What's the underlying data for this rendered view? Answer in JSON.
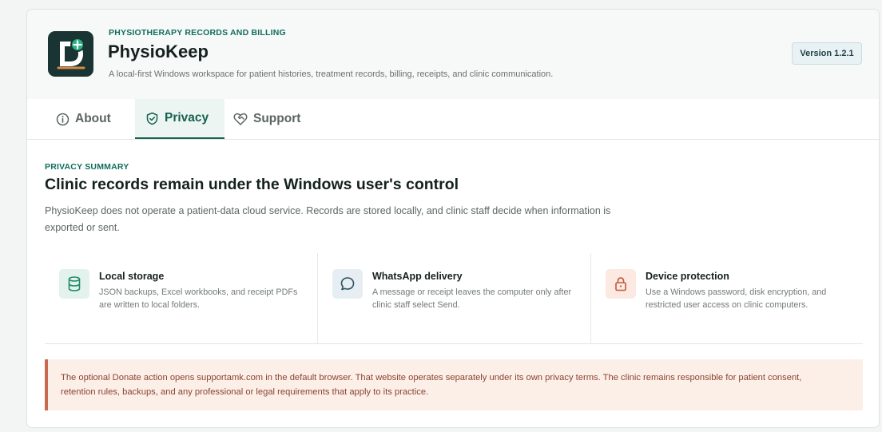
{
  "app": {
    "eyebrow": "PHYSIOTHERAPY RECORDS AND BILLING",
    "name": "PhysioKeep",
    "description": "A local-first Windows workspace for patient histories, treatment records, billing, receipts, and clinic communication.",
    "version": "Version 1.2.1"
  },
  "tabs": [
    {
      "label": "About",
      "icon": "info-icon",
      "active": false
    },
    {
      "label": "Privacy",
      "icon": "shield-check-icon",
      "active": true
    },
    {
      "label": "Support",
      "icon": "heart-handshake-icon",
      "active": false
    }
  ],
  "privacy": {
    "eyebrow": "PRIVACY SUMMARY",
    "title": "Clinic records remain under the Windows user's control",
    "description": "PhysioKeep does not operate a patient-data cloud service. Records are stored locally, and clinic staff decide when information is exported or sent.",
    "features": [
      {
        "title": "Local storage",
        "description": "JSON backups, Excel workbooks, and receipt PDFs are written to local folders.",
        "icon": "database-icon",
        "color": "#e3f2ec"
      },
      {
        "title": "WhatsApp delivery",
        "description": "A message or receipt leaves the computer only after clinic staff select Send.",
        "icon": "chat-bubble-icon",
        "color": "#e6eef3"
      },
      {
        "title": "Device protection",
        "description": "Use a Windows password, disk encryption, and restricted user access on clinic computers.",
        "icon": "lock-icon",
        "color": "#fbe9e2"
      }
    ],
    "notice": "The optional Donate action opens supportamk.com in the default browser. That website operates separately under its own privacy terms. The clinic remains responsible for patient consent, retention rules, backups, and any professional or legal requirements that apply to its practice."
  },
  "colors": {
    "accent": "#16614f",
    "eyebrow": "#0f6e5c",
    "logo_bg": "#193432",
    "notice_bg": "#fcefe8",
    "notice_border": "#c76b4e"
  }
}
